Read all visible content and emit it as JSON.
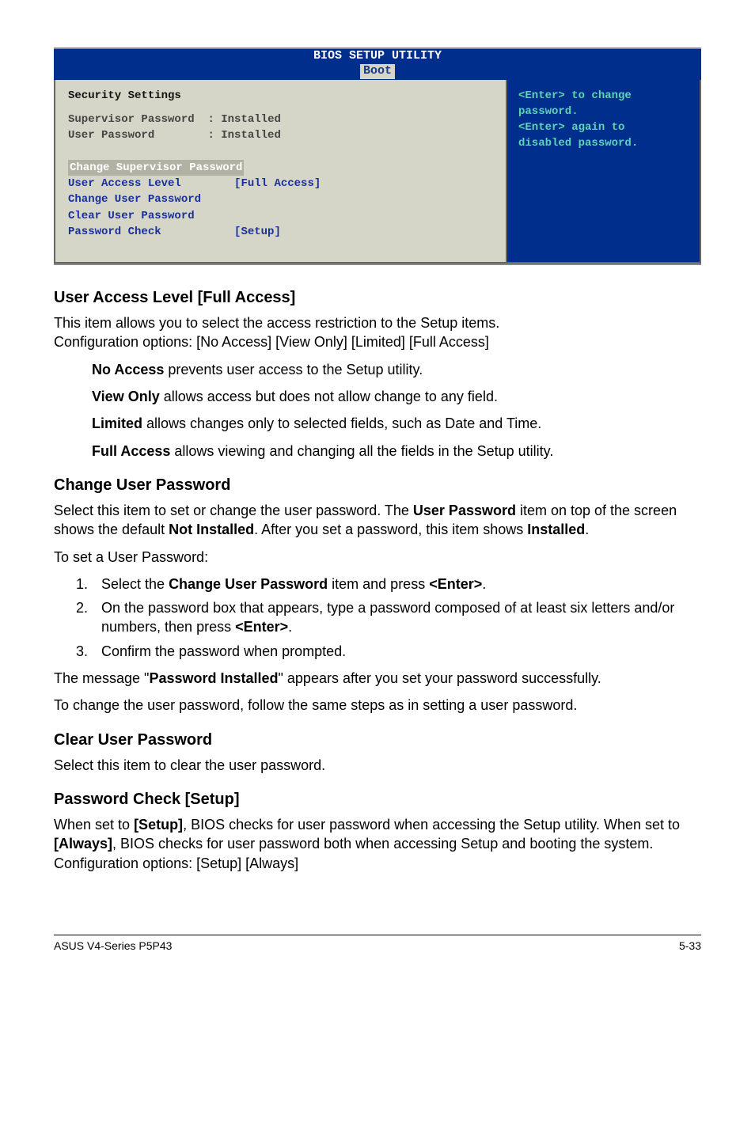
{
  "bios": {
    "utility_title": "BIOS SETUP UTILITY",
    "tab": "Boot",
    "settings_title": "Security Settings",
    "supervisor_label": "Supervisor Password",
    "supervisor_value": ": Installed",
    "userpw_label": "User Password",
    "userpw_value": ": Installed",
    "change_sup": "Change Supervisor Password",
    "ual_label": "User Access Level",
    "ual_value": "[Full Access]",
    "change_user": "Change User Password",
    "clear_user": "Clear User Password",
    "pwcheck_label": "Password Check",
    "pwcheck_value": "[Setup]",
    "help1": "<Enter> to change",
    "help2": "password.",
    "help3": "<Enter> again to",
    "help4": "disabled password."
  },
  "ual": {
    "heading": "User Access Level [Full Access]",
    "p1": "This item allows you to select the access restriction to the Setup items.",
    "p2": "Configuration options: [No Access] [View Only] [Limited] [Full Access]",
    "na_b": "No Access",
    "na_t": " prevents user access to the Setup utility.",
    "vo_b": "View Only",
    "vo_t": " allows access but does not allow change to any field.",
    "li_b": "Limited",
    "li_t": " allows changes only to selected fields, such as Date and Time.",
    "fa_b": "Full Access",
    "fa_t": " allows viewing and changing all the fields in the Setup utility."
  },
  "cup": {
    "heading": "Change User Password",
    "p1a": "Select this item to set or change the user password. The ",
    "p1b": "User Password",
    "p1c": " item on top of the screen shows the default ",
    "p1d": "Not Installed",
    "p1e": ". After you set a password, this item shows ",
    "p1f": "Installed",
    "p1g": ".",
    "p2": "To set a User Password:",
    "li1a": "Select the ",
    "li1b": "Change User Password",
    "li1c": " item and press ",
    "li1d": "<Enter>",
    "li1e": ".",
    "li2a": "On the password box that appears, type a password composed of at least six letters and/or numbers, then press ",
    "li2b": "<Enter>",
    "li2c": ".",
    "li3": "Confirm the password when prompted.",
    "p3a": "The message \"",
    "p3b": "Password Installed",
    "p3c": "\" appears after you set your password successfully.",
    "p4": "To change the user password, follow the same steps as in setting a user password."
  },
  "clr": {
    "heading": "Clear User Password",
    "p1": "Select this item to clear the user password."
  },
  "pchk": {
    "heading": "Password Check [Setup]",
    "p1a": "When set to ",
    "p1b": "[Setup]",
    "p1c": ", BIOS checks for user password when accessing the Setup utility. When set to ",
    "p1d": "[Always]",
    "p1e": ", BIOS checks for user password both when accessing Setup and booting the system. Configuration options: [Setup] [Always]"
  },
  "footer": {
    "left": "ASUS V4-Series P5P43",
    "right": "5-33"
  }
}
